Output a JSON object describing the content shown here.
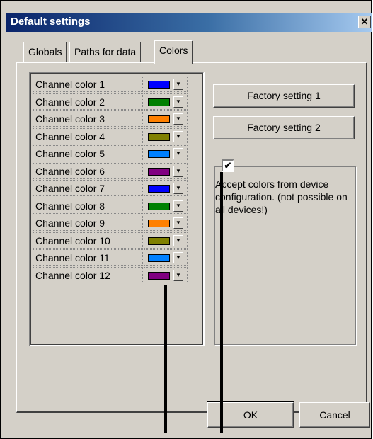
{
  "dialog": {
    "title": "Default settings",
    "close_glyph": "✕"
  },
  "tabs": [
    {
      "label": "Globals"
    },
    {
      "label": "Paths for data"
    },
    {
      "label": "Colors"
    }
  ],
  "channels": [
    {
      "label": "Channel color 1",
      "color": "#0000ff"
    },
    {
      "label": "Channel color 2",
      "color": "#008000"
    },
    {
      "label": "Channel color 3",
      "color": "#ff8000"
    },
    {
      "label": "Channel color 4",
      "color": "#808000"
    },
    {
      "label": "Channel color 5",
      "color": "#0080ff"
    },
    {
      "label": "Channel color 6",
      "color": "#800080"
    },
    {
      "label": "Channel color 7",
      "color": "#0000ff"
    },
    {
      "label": "Channel color 8",
      "color": "#008000"
    },
    {
      "label": "Channel color 9",
      "color": "#ff8000"
    },
    {
      "label": "Channel color 10",
      "color": "#808000"
    },
    {
      "label": "Channel color 11",
      "color": "#0080ff"
    },
    {
      "label": "Channel color 12",
      "color": "#800080"
    }
  ],
  "buttons": {
    "factory1": "Factory setting 1",
    "factory2": "Factory setting 2",
    "ok": "OK",
    "cancel": "Cancel"
  },
  "accept_colors": {
    "checked": true,
    "text": "Accept colors from device configuration. (not possible on all devices!)"
  }
}
